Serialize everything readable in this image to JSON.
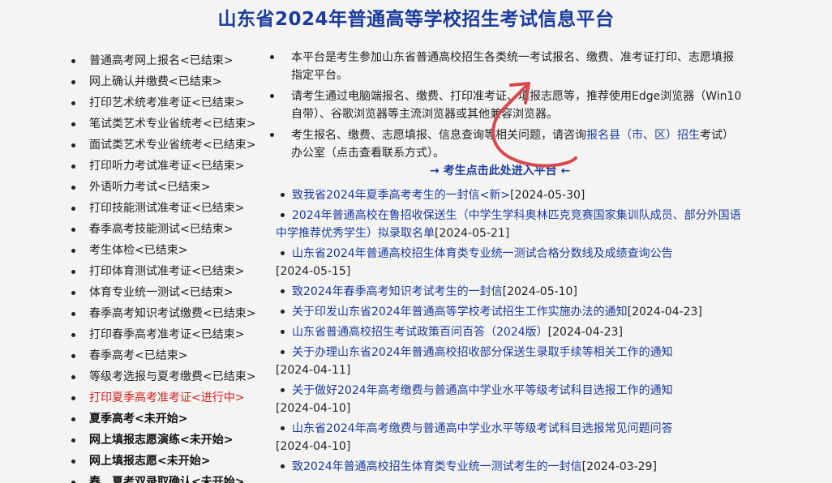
{
  "page": {
    "title": "山东省2024年普通高等学校招生考试信息平台"
  },
  "menu": {
    "items": [
      {
        "label": "普通高考网上报名<已结束>",
        "state": "done"
      },
      {
        "label": "网上确认并缴费<已结束>",
        "state": "done"
      },
      {
        "label": "打印艺术统考准考证<已结束>",
        "state": "done"
      },
      {
        "label": "笔试类艺术专业省统考<已结束>",
        "state": "done"
      },
      {
        "label": "面试类艺术专业省统考<已结束>",
        "state": "done"
      },
      {
        "label": "打印听力考试准考证<已结束>",
        "state": "done"
      },
      {
        "label": "外语听力考试<已结束>",
        "state": "done"
      },
      {
        "label": "打印技能测试准考证<已结束>",
        "state": "done"
      },
      {
        "label": "春季高考技能测试<已结束>",
        "state": "done"
      },
      {
        "label": "考生体检<已结束>",
        "state": "done"
      },
      {
        "label": "打印体育测试准考证<已结束>",
        "state": "done"
      },
      {
        "label": "体育专业统一测试<已结束>",
        "state": "done"
      },
      {
        "label": "春季高考知识考试缴费<已结束>",
        "state": "done"
      },
      {
        "label": "打印春季高考准考证<已结束>",
        "state": "done"
      },
      {
        "label": "春季高考<已结束>",
        "state": "done"
      },
      {
        "label": "等级考选报与夏考缴费<已结束>",
        "state": "done"
      },
      {
        "label": "打印夏季高考准考证<进行中>",
        "state": "active"
      },
      {
        "label": "夏季高考<未开始>",
        "state": "upcoming"
      },
      {
        "label": "网上填报志愿演练<未开始>",
        "state": "upcoming"
      },
      {
        "label": "网上填报志愿<未开始>",
        "state": "upcoming"
      },
      {
        "label": "春、夏考双录取确认<未开始>",
        "state": "upcoming"
      }
    ]
  },
  "notices": {
    "n1": "本平台是考生参加山东省普通高校招生各类统一考试报名、缴费、准考证打印、志愿填报指定平台。",
    "n2": "请考生通过电脑端报名、缴费、打印准考证、填报志愿等，推荐使用Edge浏览器（Win10自带）、谷歌浏览器等主流浏览器或其他兼容浏览器。",
    "n3_pre": "考生报名、缴费、志愿填报、信息查询等相关问题，请咨询",
    "n3_link": "报名县（市、区）招生",
    "n3_post": "考试）办公室（点击查看联系方式）。",
    "enter": "→ 考生点击此处进入平台 ←"
  },
  "news": {
    "items": [
      {
        "title": "致我省2024年夏季高考考生的一封信<新>",
        "date": "[2024-05-30]"
      },
      {
        "title": "2024年普通高校在鲁招收保送生（中学生学科奥林匹克竞赛国家集训队成员、部分外国语中学推荐优秀学生）拟录取名单",
        "date": "[2024-05-21]"
      },
      {
        "title": "山东省2024年普通高校招生体育类专业统一测试合格分数线及成绩查询公告",
        "date": "[2024-05-15]"
      },
      {
        "title": "致2024年春季高考知识考试考生的一封信",
        "date": "[2024-05-10]"
      },
      {
        "title": "关于印发山东省2024年普通高等学校考试招生工作实施办法的通知",
        "date": "[2024-04-23]"
      },
      {
        "title": "山东省普通高校招生考试政策百问百答（2024版）",
        "date": "[2024-04-23]"
      },
      {
        "title": "关于办理山东省2024年普通高校招收部分保送生录取手续等相关工作的通知",
        "date": "[2024-04-11]"
      },
      {
        "title": "关于做好2024年高考缴费与普通高中学业水平等级考试科目选报工作的通知",
        "date": "[2024-04-10]"
      },
      {
        "title": "山东省2024年高考缴费与普通高中学业水平等级考试科目选报常见问题问答",
        "date": "[2024-04-10]"
      },
      {
        "title": "致2024年普通高校招生体育类专业统一测试考生的一封信",
        "date": "[2024-03-29]"
      }
    ]
  },
  "colors": {
    "title": "#1b3b9e",
    "link": "#1b3b9e",
    "active": "#d42020",
    "annotation_arrow": "#d9484f"
  }
}
